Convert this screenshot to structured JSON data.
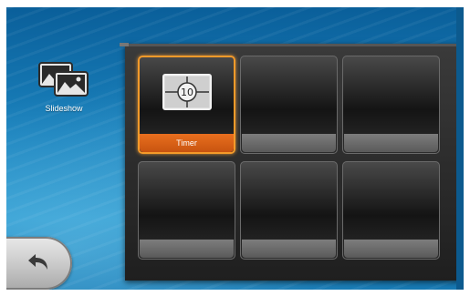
{
  "mode": {
    "label": "Slideshow",
    "icon": "photos-icon"
  },
  "back": {
    "icon": "back-arrow-icon"
  },
  "grid": {
    "slots": [
      {
        "label": "Timer",
        "icon": "timer-icon",
        "selected": true
      },
      {
        "label": "",
        "selected": false
      },
      {
        "label": "",
        "selected": false
      },
      {
        "label": "",
        "selected": false
      },
      {
        "label": "",
        "selected": false
      },
      {
        "label": "",
        "selected": false
      }
    ],
    "timer_value": "10"
  },
  "colors": {
    "accent": "#e96f1e",
    "background": "#1a82bd"
  }
}
